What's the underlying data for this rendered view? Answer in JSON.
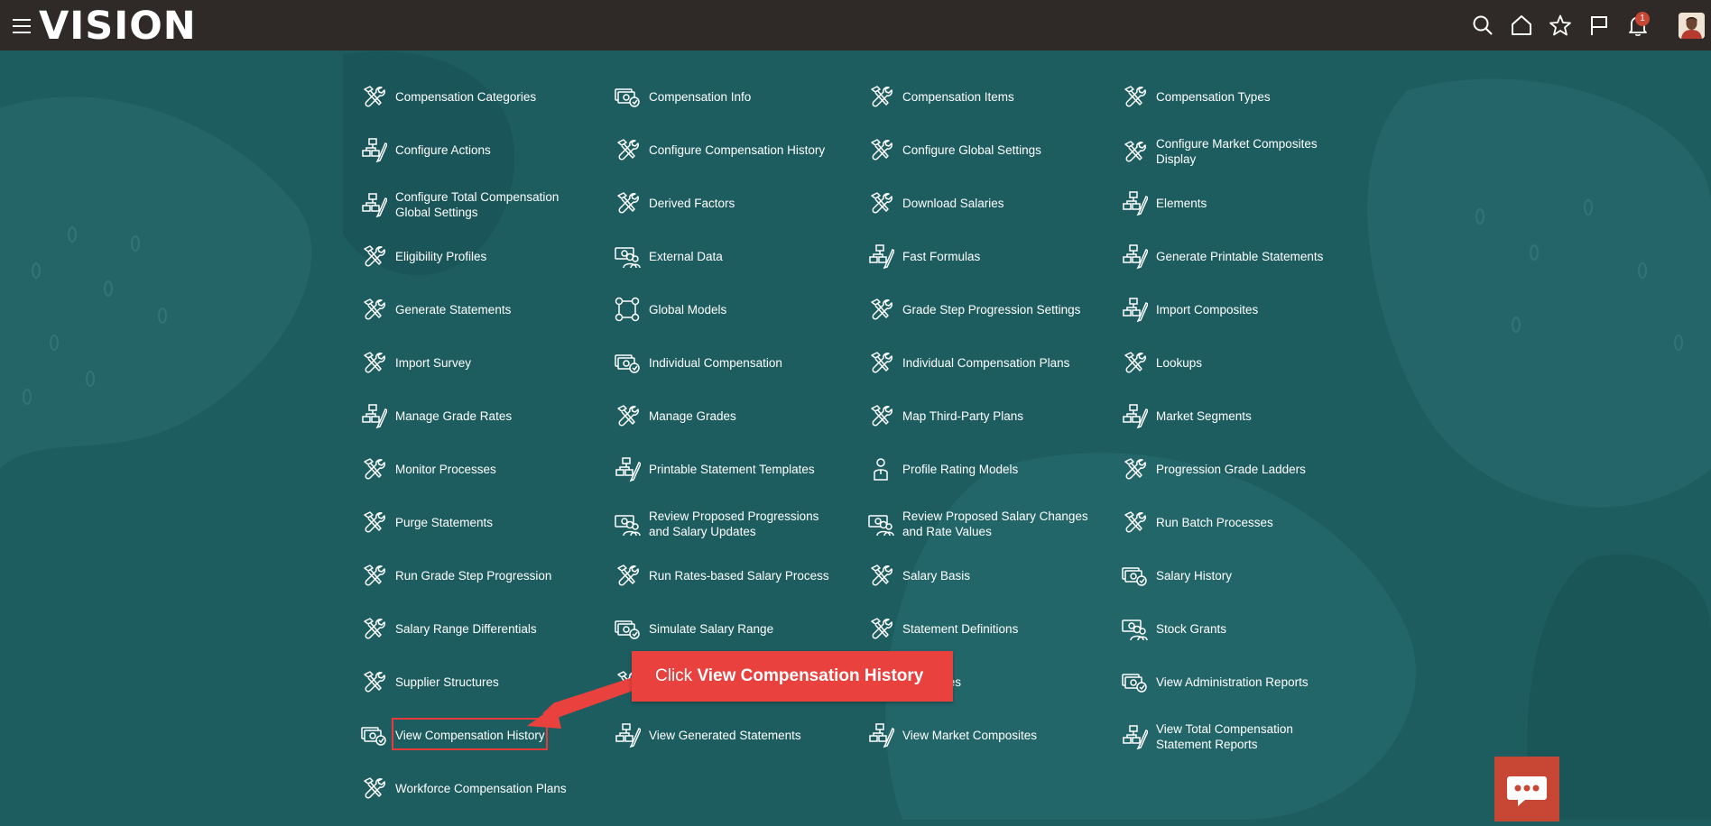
{
  "header": {
    "logo": "VISION",
    "notification_count": "1"
  },
  "callout": {
    "prefix": "Click",
    "emphasis": "View Compensation History"
  },
  "items": [
    {
      "label": "Compensation Categories",
      "icon": "wrench-tools-icon"
    },
    {
      "label": "Compensation Info",
      "icon": "money-icon"
    },
    {
      "label": "Compensation Items",
      "icon": "wrench-tools-icon"
    },
    {
      "label": "Compensation Types",
      "icon": "wrench-tools-icon"
    },
    {
      "label": "Configure Actions",
      "icon": "hierarchy-icon"
    },
    {
      "label": "Configure Compensation History",
      "icon": "wrench-tools-icon"
    },
    {
      "label": "Configure Global Settings",
      "icon": "wrench-tools-icon"
    },
    {
      "label": "Configure Market Composites Display",
      "icon": "wrench-tools-icon"
    },
    {
      "label": "Configure Total Compensation Global Settings",
      "icon": "hierarchy-icon"
    },
    {
      "label": "Derived Factors",
      "icon": "wrench-tools-icon"
    },
    {
      "label": "Download Salaries",
      "icon": "wrench-tools-icon"
    },
    {
      "label": "Elements",
      "icon": "hierarchy-icon"
    },
    {
      "label": "Eligibility Profiles",
      "icon": "wrench-tools-icon"
    },
    {
      "label": "External Data",
      "icon": "people-money-icon"
    },
    {
      "label": "Fast Formulas",
      "icon": "hierarchy-icon"
    },
    {
      "label": "Generate Printable Statements",
      "icon": "hierarchy-icon"
    },
    {
      "label": "Generate Statements",
      "icon": "wrench-tools-icon"
    },
    {
      "label": "Global Models",
      "icon": "network-icon"
    },
    {
      "label": "Grade Step Progression Settings",
      "icon": "wrench-tools-icon"
    },
    {
      "label": "Import Composites",
      "icon": "hierarchy-icon"
    },
    {
      "label": "Import Survey",
      "icon": "wrench-tools-icon"
    },
    {
      "label": "Individual Compensation",
      "icon": "money-icon"
    },
    {
      "label": "Individual Compensation Plans",
      "icon": "wrench-tools-icon"
    },
    {
      "label": "Lookups",
      "icon": "wrench-tools-icon"
    },
    {
      "label": "Manage Grade Rates",
      "icon": "hierarchy-icon"
    },
    {
      "label": "Manage Grades",
      "icon": "wrench-tools-icon"
    },
    {
      "label": "Map Third-Party Plans",
      "icon": "wrench-tools-icon"
    },
    {
      "label": "Market Segments",
      "icon": "hierarchy-icon"
    },
    {
      "label": "Monitor Processes",
      "icon": "wrench-tools-icon"
    },
    {
      "label": "Printable Statement Templates",
      "icon": "hierarchy-icon"
    },
    {
      "label": "Profile Rating Models",
      "icon": "person-badge-icon"
    },
    {
      "label": "Progression Grade Ladders",
      "icon": "wrench-tools-icon"
    },
    {
      "label": "Purge Statements",
      "icon": "wrench-tools-icon"
    },
    {
      "label": "Review Proposed Progressions and Salary Updates",
      "icon": "people-money-icon"
    },
    {
      "label": "Review Proposed Salary Changes and Rate Values",
      "icon": "people-money-icon"
    },
    {
      "label": "Run Batch Processes",
      "icon": "wrench-tools-icon"
    },
    {
      "label": "Run Grade Step Progression",
      "icon": "wrench-tools-icon"
    },
    {
      "label": "Run Rates-based Salary Process",
      "icon": "wrench-tools-icon"
    },
    {
      "label": "Salary Basis",
      "icon": "wrench-tools-icon"
    },
    {
      "label": "Salary History",
      "icon": "money-icon"
    },
    {
      "label": "Salary Range Differentials",
      "icon": "wrench-tools-icon"
    },
    {
      "label": "Simulate Salary Range",
      "icon": "money-icon"
    },
    {
      "label": "Statement Definitions",
      "icon": "wrench-tools-icon"
    },
    {
      "label": "Stock Grants",
      "icon": "people-money-icon"
    },
    {
      "label": "Supplier Structures",
      "icon": "wrench-tools-icon"
    },
    {
      "label": "",
      "icon": "wrench-tools-icon"
    },
    {
      "label": "ned Tables",
      "icon": "wrench-tools-icon"
    },
    {
      "label": "View Administration Reports",
      "icon": "money-icon"
    },
    {
      "label": "View Compensation History",
      "icon": "money-icon"
    },
    {
      "label": "View Generated Statements",
      "icon": "hierarchy-icon"
    },
    {
      "label": "View Market Composites",
      "icon": "hierarchy-icon"
    },
    {
      "label": "View Total Compensation Statement Reports",
      "icon": "hierarchy-icon"
    },
    {
      "label": "Workforce Compensation Plans",
      "icon": "wrench-tools-icon"
    }
  ]
}
